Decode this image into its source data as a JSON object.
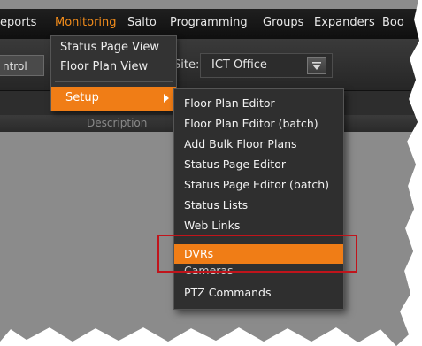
{
  "menubar": {
    "items": [
      "eports",
      "Monitoring",
      "Salto",
      "Programming",
      "Groups",
      "Expanders",
      "Boo"
    ]
  },
  "toolbar": {
    "control_text": "ntrol",
    "site_label": "Site:",
    "site_value": "ICT Office"
  },
  "table": {
    "description_header": "Description"
  },
  "monitoring_menu": {
    "items": [
      "Status Page View",
      "Floor Plan View"
    ],
    "setup_label": "Setup"
  },
  "setup_menu": {
    "items": [
      "Floor Plan Editor",
      "Floor Plan Editor (batch)",
      "Add Bulk Floor Plans",
      "Status Page Editor",
      "Status Page Editor (batch)",
      "Status Lists",
      "Web Links"
    ],
    "highlighted": "DVRs",
    "after": [
      "Cameras",
      "PTZ Commands"
    ]
  },
  "colors": {
    "accent": "#f07d16",
    "annotation": "#c0141b"
  }
}
